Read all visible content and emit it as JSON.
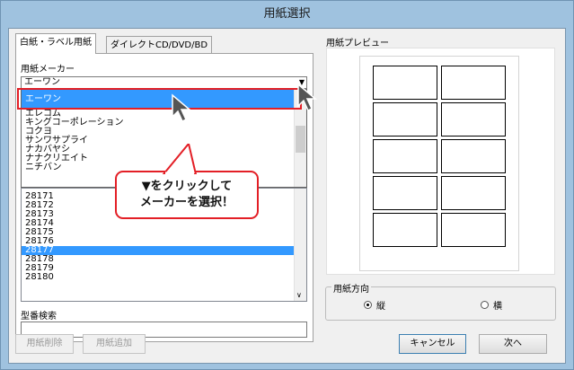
{
  "window": {
    "title": "用紙選択"
  },
  "tabs": [
    {
      "label": "白紙・ラベル用紙"
    },
    {
      "label": "ダイレクトCD/DVD/BD"
    }
  ],
  "maker": {
    "label": "用紙メーカー",
    "combo_value": "エーワン",
    "highlighted_item": "エーワン",
    "dropdown_items": [
      "エレコム",
      "キングコーポレーション",
      "コクヨ",
      "サンワサプライ",
      "ナカバヤシ",
      "ナナクリエイト",
      "ニチバン"
    ]
  },
  "model_list": {
    "items": [
      "28171",
      "28172",
      "28173",
      "28174",
      "28175",
      "28176",
      "28177",
      "28178",
      "28179",
      "28180"
    ],
    "selected": "28177"
  },
  "search": {
    "label": "型番検索",
    "value": ""
  },
  "buttons": {
    "delete": "用紙削除",
    "add": "用紙追加",
    "cancel": "キャンセル",
    "next": "次へ"
  },
  "preview": {
    "label": "用紙プレビュー"
  },
  "orientation": {
    "label": "用紙方向",
    "options": [
      {
        "label": "縦",
        "selected": true
      },
      {
        "label": "横",
        "selected": false
      }
    ]
  },
  "callout": {
    "text": "▼をクリックして\nメーカーを選択！"
  },
  "colors": {
    "highlight": "#e31f26",
    "selection": "#3399ff",
    "titlebar": "#9fc2df"
  }
}
